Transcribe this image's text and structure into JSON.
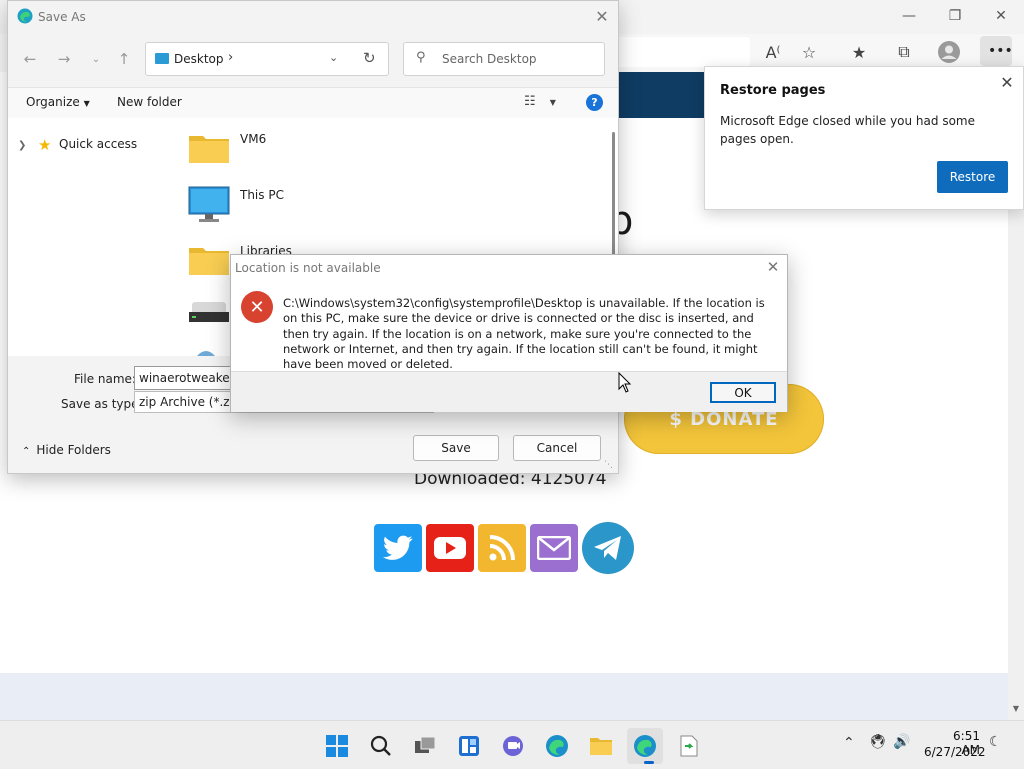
{
  "browser": {
    "site_heading_fragment": "p",
    "donate_label": "$ DONATE",
    "downloaded_text": "Downloaded: 4125074",
    "social_icons": [
      "twitter-icon",
      "youtube-icon",
      "rss-icon",
      "email-icon",
      "telegram-icon"
    ],
    "colors": {
      "header": "#0f3c63",
      "donate": "#f3c53a"
    }
  },
  "restore_popup": {
    "title": "Restore pages",
    "message": "Microsoft Edge closed while you had some pages open.",
    "button": "Restore"
  },
  "save_as": {
    "title": "Save As",
    "path": "Desktop",
    "search_placeholder": "Search Desktop",
    "organize": "Organize",
    "new_folder": "New folder",
    "nav": {
      "quick_access": "Quick access"
    },
    "items": [
      {
        "name": "VM6",
        "type": "folder"
      },
      {
        "name": "This PC",
        "type": "computer"
      },
      {
        "name": "Libraries",
        "type": "folder"
      }
    ],
    "file_name_label": "File name:",
    "file_name_value": "winaerotweaker.zip",
    "save_type_label": "Save as type:",
    "save_type_value": "zip Archive (*.zip)",
    "hide_folders": "Hide Folders",
    "save_button": "Save",
    "cancel_button": "Cancel"
  },
  "error_dialog": {
    "title": "Location is not available",
    "message": "C:\\Windows\\system32\\config\\systemprofile\\Desktop is unavailable. If the location is on this PC, make sure the device or drive is connected or the disc is inserted, and then try again. If the location is on a network, make sure you're connected to the network or Internet, and then try again. If the location still can't be found, it might have been moved or deleted.",
    "ok_button": "OK"
  },
  "taskbar": {
    "time": "6:51 AM",
    "date": "6/27/2022"
  }
}
